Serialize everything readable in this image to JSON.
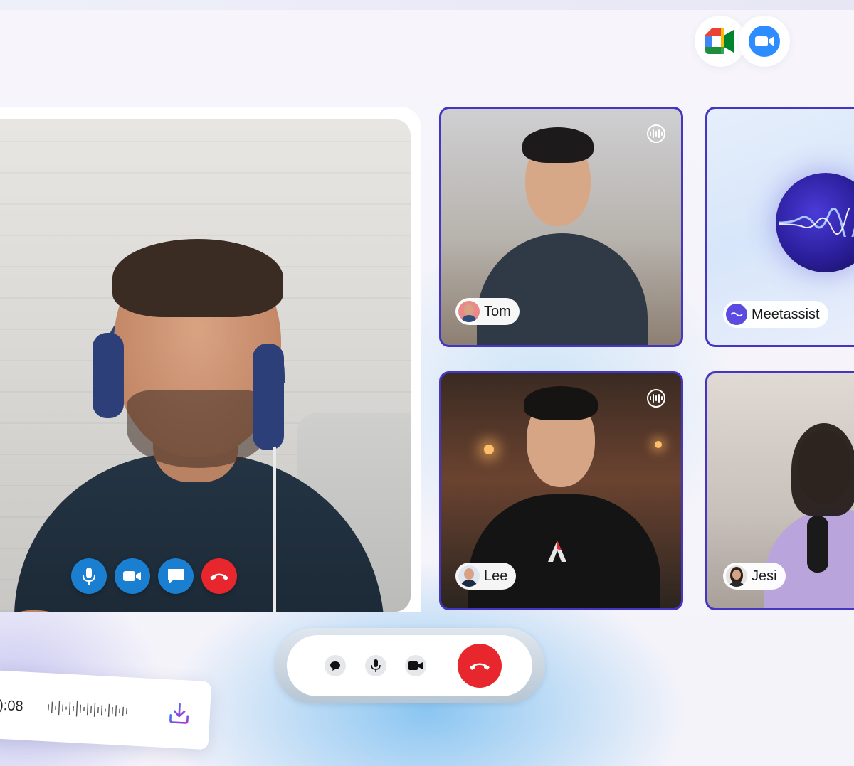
{
  "platforms": [
    {
      "name": "Google Meet",
      "icon": "google-meet-icon"
    },
    {
      "name": "Zoom",
      "icon": "zoom-icon"
    }
  ],
  "main_speaker": {
    "controls": [
      {
        "name": "microphone",
        "icon": "microphone-icon",
        "color": "#1a7fd0"
      },
      {
        "name": "camera",
        "icon": "video-camera-icon",
        "color": "#1a7fd0"
      },
      {
        "name": "chat",
        "icon": "chat-icon",
        "color": "#1a7fd0"
      },
      {
        "name": "end-call",
        "icon": "phone-hangup-icon",
        "color": "#e8262d"
      }
    ]
  },
  "participants": [
    {
      "name": "Tom",
      "speaking_indicator": true
    },
    {
      "name": "Meetassist",
      "speaking_indicator": false
    },
    {
      "name": "Lee",
      "speaking_indicator": true
    },
    {
      "name": "Jesi",
      "speaking_indicator": false
    }
  ],
  "bottom_controls": [
    {
      "name": "chat",
      "icon": "chat-icon"
    },
    {
      "name": "microphone",
      "icon": "microphone-icon"
    },
    {
      "name": "camera",
      "icon": "video-camera-icon"
    },
    {
      "name": "end-call",
      "icon": "phone-hangup-icon",
      "color": "#e8262d"
    }
  ],
  "recording": {
    "time": "):08",
    "icon": "download-icon"
  },
  "colors": {
    "tile_border": "#4435c2",
    "control_blue": "#1a7fd0",
    "end_red": "#e8262d"
  }
}
